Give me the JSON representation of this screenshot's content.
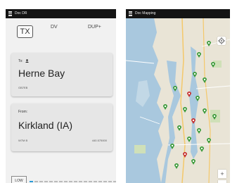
{
  "left_phone": {
    "statusbar_title": "Doc DR",
    "tx_label": "TX",
    "mode_dv": "DV",
    "mode_dup": "DUP+",
    "to_card": {
      "label": "To:",
      "destination": "Herne Bay",
      "callsign": "GB7EB"
    },
    "from_card": {
      "label": "From:",
      "repeater": "Kirkland (IA)",
      "info_left": "W7M B",
      "info_right": "440.575000"
    },
    "low_label": "LOW",
    "power_level_fraction": 0.05
  },
  "right_phone": {
    "statusbar_title": "Doc Mapping",
    "zoom_in": "+",
    "zoom_out": "−",
    "icons": {
      "my_location": "my-location-icon",
      "marker": "repeater-marker-icon"
    }
  },
  "colors": {
    "statusbar": "#141414",
    "card": "#e6e6e6",
    "accent": "#2a9ad6",
    "water": "#a9c8de",
    "land": "#e9e4d6",
    "marker_green": "#3a9a3a",
    "marker_red": "#c62f2f"
  }
}
